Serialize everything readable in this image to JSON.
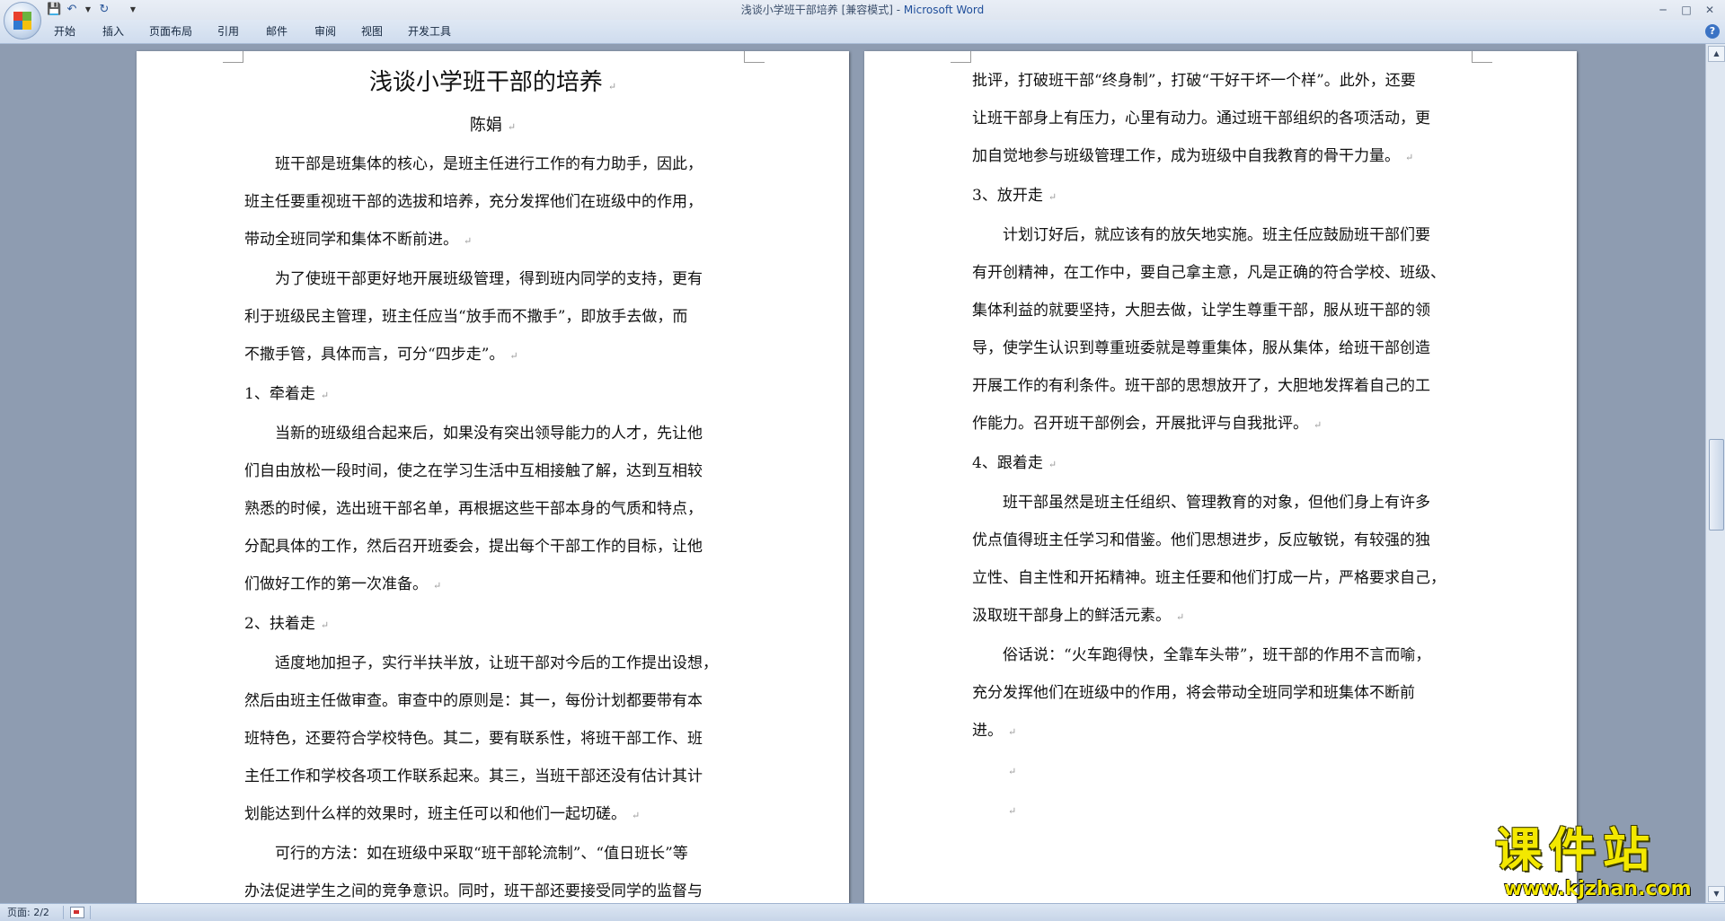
{
  "window": {
    "title": "浅谈小学班干部培养 [兼容模式] - ",
    "app_name": "Microsoft Word"
  },
  "qat": {
    "save_icon": "💾",
    "undo_icon": "↶",
    "redo_icon": "↻",
    "dropdown_icon": "▼"
  },
  "window_controls": {
    "minimize": "─",
    "maximize": "□",
    "close": "✕"
  },
  "ribbon": {
    "tabs": [
      "开始",
      "插入",
      "页面布局",
      "引用",
      "邮件",
      "审阅",
      "视图",
      "开发工具"
    ],
    "help_icon": "?"
  },
  "document": {
    "title": "浅谈小学班干部的培养",
    "author": "陈娟",
    "pilcrow": "↵",
    "page1_lines": [
      {
        "text": "班干部是班集体的核心，是班主任进行工作的有力助手，因此，",
        "indent": true
      },
      {
        "text": "班主任要重视班干部的选拔和培养，充分发挥他们在班级中的作用，",
        "indent": false
      },
      {
        "text": "带动全班同学和集体不断前进。",
        "indent": false,
        "end": true
      },
      {
        "text": "为了使班干部更好地开展班级管理，得到班内同学的支持，更有",
        "indent": true
      },
      {
        "text": "利于班级民主管理，班主任应当“放手而不撒手”，即放手去做，而",
        "indent": false
      },
      {
        "text": "不撒手管，具体而言，可分“四步走”。",
        "indent": false,
        "end": true
      },
      {
        "text": "1、牵着走",
        "indent": false,
        "end": true
      },
      {
        "text": "当新的班级组合起来后，如果没有突出领导能力的人才，先让他",
        "indent": true
      },
      {
        "text": "们自由放松一段时间，使之在学习生活中互相接触了解，达到互相较",
        "indent": false
      },
      {
        "text": "熟悉的时候，选出班干部名单，再根据这些干部本身的气质和特点，",
        "indent": false
      },
      {
        "text": "分配具体的工作，然后召开班委会，提出每个干部工作的目标，让他",
        "indent": false
      },
      {
        "text": "们做好工作的第一次准备。",
        "indent": false,
        "end": true
      },
      {
        "text": "2、扶着走",
        "indent": false,
        "end": true
      },
      {
        "text": "适度地加担子，实行半扶半放，让班干部对今后的工作提出设想，",
        "indent": true
      },
      {
        "text": "然后由班主任做审查。审查中的原则是：其一，每份计划都要带有本",
        "indent": false
      },
      {
        "text": "班特色，还要符合学校特色。其二，要有联系性，将班干部工作、班",
        "indent": false
      },
      {
        "text": "主任工作和学校各项工作联系起来。其三，当班干部还没有估计其计",
        "indent": false
      },
      {
        "text": "划能达到什么样的效果时，班主任可以和他们一起切磋。",
        "indent": false,
        "end": true
      },
      {
        "text": "可行的方法：如在班级中采取“班干部轮流制”、“值日班长”等",
        "indent": true
      },
      {
        "text": "办法促进学生之间的竞争意识。同时，班干部还要接受同学的监督与",
        "indent": false
      }
    ],
    "page2_lines": [
      {
        "text": "批评，打破班干部“终身制”，打破“干好干坏一个样”。此外，还要",
        "indent": false
      },
      {
        "text": "让班干部身上有压力，心里有动力。通过班干部组织的各项活动，更",
        "indent": false
      },
      {
        "text": "加自觉地参与班级管理工作，成为班级中自我教育的骨干力量。",
        "indent": false,
        "end": true
      },
      {
        "text": "3、放开走",
        "indent": false,
        "end": true
      },
      {
        "text": "计划订好后，就应该有的放矢地实施。班主任应鼓励班干部们要",
        "indent": true
      },
      {
        "text": "有开创精神，在工作中，要自己拿主意，凡是正确的符合学校、班级、",
        "indent": false
      },
      {
        "text": "集体利益的就要坚持，大胆去做，让学生尊重干部，服从班干部的领",
        "indent": false
      },
      {
        "text": "导，使学生认识到尊重班委就是尊重集体，服从集体，给班干部创造",
        "indent": false
      },
      {
        "text": "开展工作的有利条件。班干部的思想放开了，大胆地发挥着自己的工",
        "indent": false
      },
      {
        "text": "作能力。召开班干部例会，开展批评与自我批评。",
        "indent": false,
        "end": true
      },
      {
        "text": "4、跟着走",
        "indent": false,
        "end": true
      },
      {
        "text": "班干部虽然是班主任组织、管理教育的对象，但他们身上有许多",
        "indent": true
      },
      {
        "text": "优点值得班主任学习和借鉴。他们思想进步，反应敏锐，有较强的独",
        "indent": false
      },
      {
        "text": "立性、自主性和开拓精神。班主任要和他们打成一片，严格要求自己，",
        "indent": false
      },
      {
        "text": "汲取班干部身上的鲜活元素。",
        "indent": false,
        "end": true
      },
      {
        "text": "俗话说：“火车跑得快，全靠车头带”，班干部的作用不言而喻，",
        "indent": true
      },
      {
        "text": "充分发挥他们在班级中的作用，将会带动全班同学和班集体不断前",
        "indent": false
      },
      {
        "text": "进。",
        "indent": false,
        "end": true
      },
      {
        "text": "",
        "indent": true,
        "end": true
      },
      {
        "text": "",
        "indent": true,
        "end": true
      }
    ]
  },
  "statusbar": {
    "page_count": "页面: 2/2"
  },
  "scrollbar": {
    "up": "▲",
    "down": "▼"
  },
  "watermark": {
    "main": "课件站",
    "url": "www.kjzhan.com"
  },
  "colors": {
    "office_red": "#e8412c",
    "office_green": "#6bb33e",
    "office_blue": "#2f79d1",
    "office_yellow": "#f5c00f"
  }
}
